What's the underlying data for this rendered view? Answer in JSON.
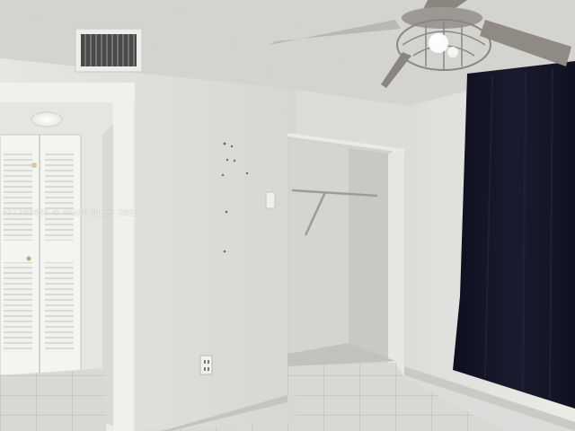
{
  "photo": {
    "watermark": "A11380659 © Miami MLS® 2025"
  },
  "colors": {
    "ceiling": "#d2d2cf",
    "wall_left": "#e2e2df",
    "wall_center": "#dadad7",
    "wall_right": "#e4e4e1",
    "closet_interior": "#d0d0cc",
    "floor_tile": "#d6d6d2",
    "grout": "#b9b9b4",
    "curtain": "#141425",
    "door_panel": "#f3f3f0"
  }
}
